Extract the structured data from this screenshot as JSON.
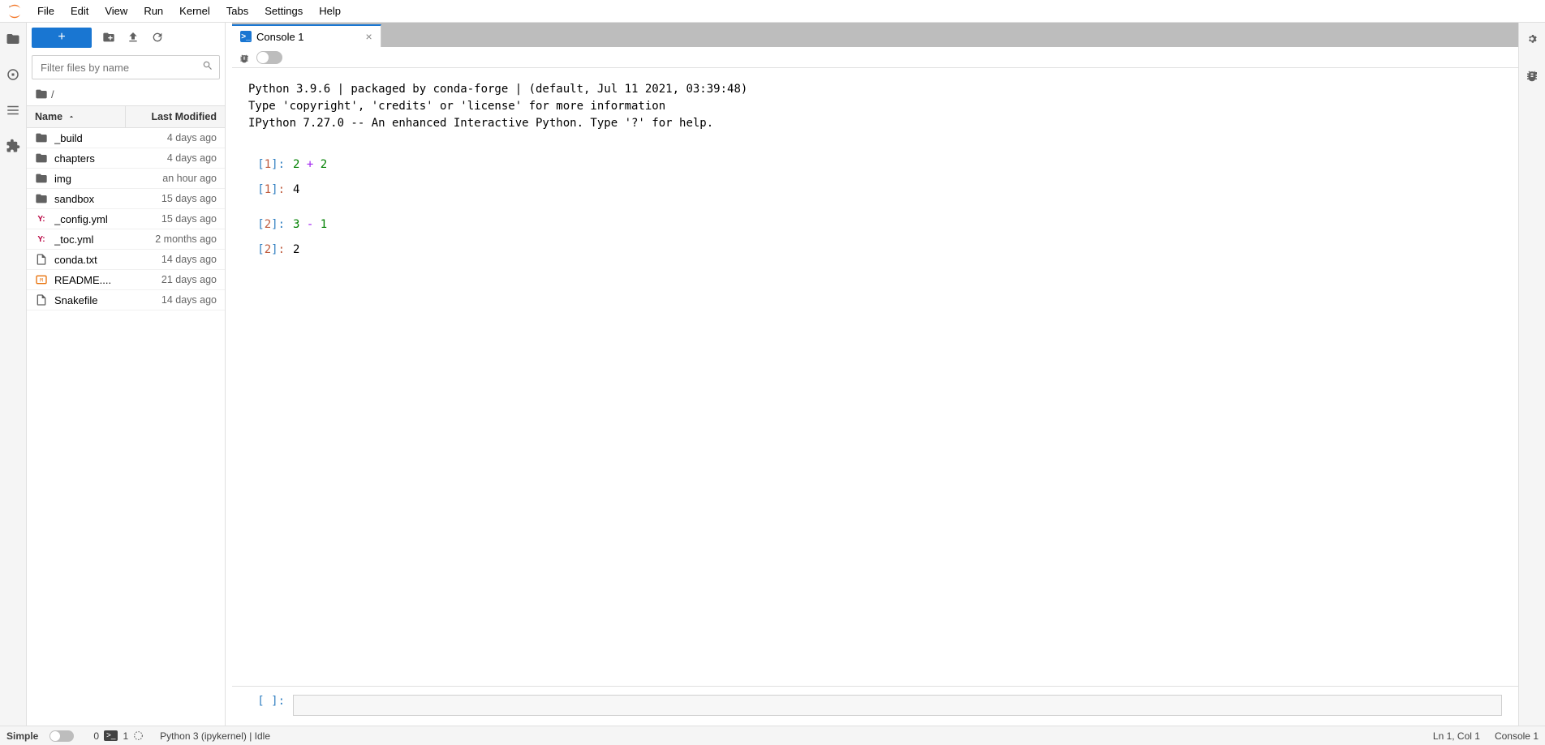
{
  "menubar": {
    "items": [
      "File",
      "Edit",
      "View",
      "Run",
      "Kernel",
      "Tabs",
      "Settings",
      "Help"
    ]
  },
  "filepanel": {
    "filter_placeholder": "Filter files by name",
    "breadcrumb_root": "/",
    "header_name": "Name",
    "header_modified": "Last Modified",
    "files": [
      {
        "name": "_build",
        "type": "folder",
        "modified": "4 days ago"
      },
      {
        "name": "chapters",
        "type": "folder",
        "modified": "4 days ago"
      },
      {
        "name": "img",
        "type": "folder",
        "modified": "an hour ago"
      },
      {
        "name": "sandbox",
        "type": "folder",
        "modified": "15 days ago"
      },
      {
        "name": "_config.yml",
        "type": "yaml",
        "modified": "15 days ago"
      },
      {
        "name": "_toc.yml",
        "type": "yaml",
        "modified": "2 months ago"
      },
      {
        "name": "conda.txt",
        "type": "file",
        "modified": "14 days ago"
      },
      {
        "name": "README....",
        "type": "md",
        "modified": "21 days ago"
      },
      {
        "name": "Snakefile",
        "type": "file",
        "modified": "14 days ago"
      }
    ]
  },
  "tab": {
    "label": "Console 1"
  },
  "console": {
    "banner_l1": "Python 3.9.6 | packaged by conda-forge | (default, Jul 11 2021, 03:39:48)",
    "banner_l2": "Type 'copyright', 'credits' or 'license' for more information",
    "banner_l3": "IPython 7.27.0 -- An enhanced Interactive Python. Type '?' for help.",
    "cells": [
      {
        "in_n": "1",
        "code_a": "2",
        "code_op": "+",
        "code_b": "2",
        "out_n": "1",
        "out": "4"
      },
      {
        "in_n": "2",
        "code_a": "3",
        "code_op": "-",
        "code_b": "1",
        "out_n": "2",
        "out": "2"
      }
    ],
    "input_prompt": "[ ]:"
  },
  "status": {
    "simple_label": "Simple",
    "count_a": "0",
    "count_b": "1",
    "kernel": "Python 3 (ipykernel) | Idle",
    "lncol": "Ln 1, Col 1",
    "right_label": "Console 1"
  }
}
